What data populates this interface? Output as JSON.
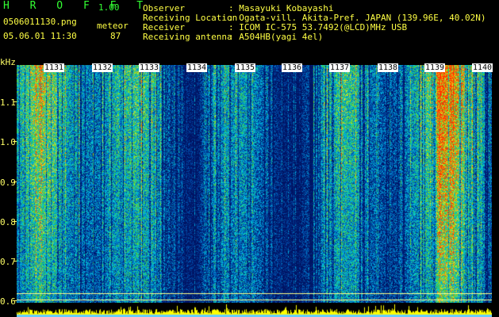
{
  "header": {
    "app_title": "H R O F F T",
    "version": "1.00",
    "filename": "0506011130.png",
    "datetime": "05.06.01 11:30",
    "meteor_label": "meteor",
    "meteor_count": "87"
  },
  "info": [
    {
      "label": "Observer",
      "value": ": Masayuki Kobayashi"
    },
    {
      "label": "Receiving Location",
      "value": ": Ogata-vill. Akita-Pref. JAPAN (139.96E, 40.02N)"
    },
    {
      "label": "Receiver",
      "value": ": ICOM IC-575 53.7492(@LCD)MHz USB"
    },
    {
      "label": "Receiving antenna",
      "value": ": A504HB(yagi 4el)"
    }
  ],
  "axis": {
    "unit": "kHz",
    "y_ticks": [
      "1.1",
      "1.0",
      "0.9",
      "0.8",
      "0.7",
      "0.6"
    ],
    "minute_labels": [
      "1131",
      "1132",
      "1133",
      "1134",
      "1135",
      "1136",
      "1137",
      "1138",
      "1139",
      "1140"
    ]
  },
  "colors": {
    "background": "#000000",
    "text_yellow": "#ffff44",
    "title_green": "#33ff33",
    "spectrum_low": "#00206a",
    "spectrum_high": "#ff4000"
  }
}
